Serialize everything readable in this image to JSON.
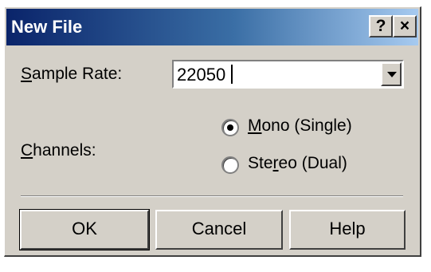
{
  "window": {
    "title": "New File",
    "help_button": "?",
    "close_button": "×"
  },
  "sample_rate": {
    "label_underlined": "S",
    "label_rest": "ample Rate:",
    "value": "22050"
  },
  "channels": {
    "label_underlined": "C",
    "label_rest": "hannels:",
    "options": [
      {
        "pre": "",
        "underlined": "M",
        "post": "ono (Single)",
        "selected": true
      },
      {
        "pre": "Ste",
        "underlined": "r",
        "post": "eo (Dual)",
        "selected": false
      }
    ]
  },
  "buttons": {
    "ok": "OK",
    "cancel": "Cancel",
    "help": "Help"
  }
}
